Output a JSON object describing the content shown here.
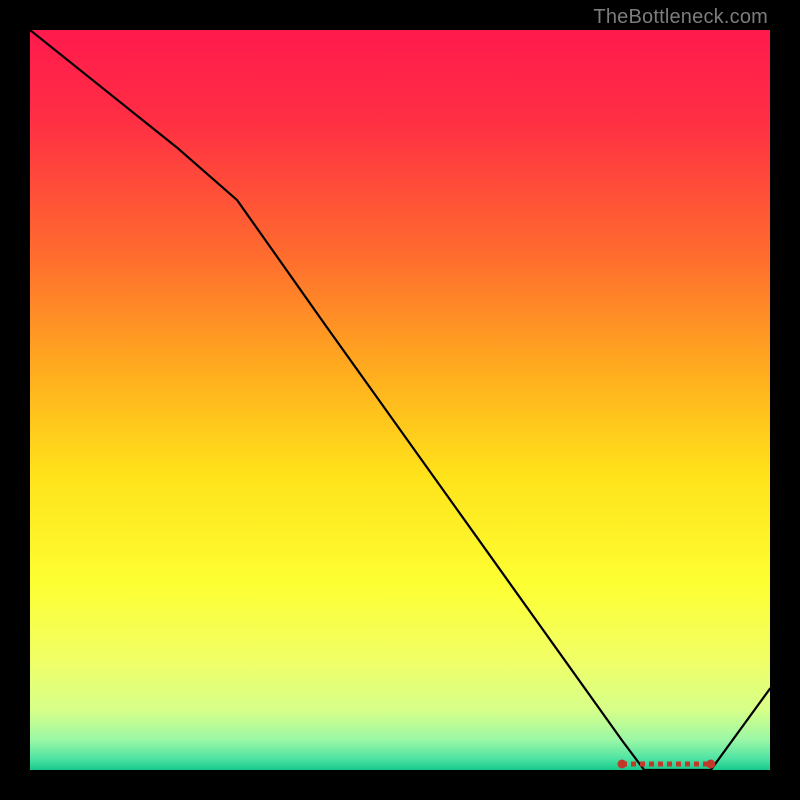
{
  "watermark": "TheBottleneck.com",
  "chart_data": {
    "type": "line",
    "x": [
      0.0,
      0.1,
      0.2,
      0.28,
      0.4,
      0.5,
      0.6,
      0.7,
      0.8,
      0.83,
      0.9,
      0.92,
      1.0
    ],
    "values": [
      1.0,
      0.92,
      0.84,
      0.77,
      0.6,
      0.46,
      0.32,
      0.18,
      0.04,
      0.0,
      0.0,
      0.0,
      0.11
    ],
    "optimal_band": {
      "x_start": 0.8,
      "x_end": 0.92,
      "y": 0.0
    },
    "xlabel": "",
    "ylabel": "",
    "xlim": [
      0,
      1
    ],
    "ylim": [
      0,
      1
    ],
    "title": "",
    "grid": false,
    "legend": false,
    "background_gradient": {
      "stops": [
        {
          "offset": 0.0,
          "color": "#ff1a4d"
        },
        {
          "offset": 0.12,
          "color": "#ff2e44"
        },
        {
          "offset": 0.3,
          "color": "#ff6a2f"
        },
        {
          "offset": 0.45,
          "color": "#ffa81f"
        },
        {
          "offset": 0.6,
          "color": "#ffe21a"
        },
        {
          "offset": 0.75,
          "color": "#fdff33"
        },
        {
          "offset": 0.85,
          "color": "#f1ff66"
        },
        {
          "offset": 0.92,
          "color": "#d6ff8a"
        },
        {
          "offset": 0.96,
          "color": "#99f7a6"
        },
        {
          "offset": 0.985,
          "color": "#4de3a3"
        },
        {
          "offset": 1.0,
          "color": "#17c98b"
        }
      ]
    }
  }
}
